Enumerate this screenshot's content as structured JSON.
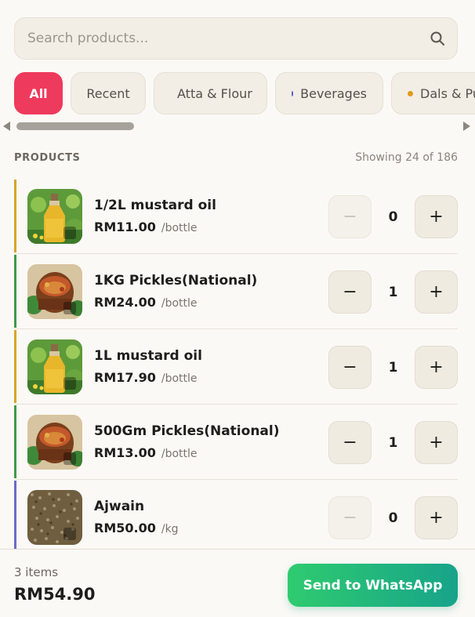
{
  "search": {
    "placeholder": "Search products..."
  },
  "categories": [
    {
      "label": "All",
      "active": true,
      "dot": ""
    },
    {
      "label": "Recent",
      "active": false,
      "dot": ""
    },
    {
      "label": "Atta & Flour",
      "active": false,
      "dot": "#b6581d"
    },
    {
      "label": "Beverages",
      "active": false,
      "dot": "#5757cc"
    },
    {
      "label": "Dals & Pu",
      "active": false,
      "dot": "#e09a1c"
    }
  ],
  "list": {
    "title": "PRODUCTS",
    "count": "Showing 24 of 186"
  },
  "products": [
    {
      "name": "1/2L mustard oil",
      "price": "RM11.00",
      "unit": "/bottle",
      "qty": "0",
      "accent": "#d9a42a",
      "image": "oil-bottle"
    },
    {
      "name": "1KG Pickles(National)",
      "price": "RM24.00",
      "unit": "/bottle",
      "qty": "1",
      "accent": "#3f9a4a",
      "image": "pickle-jar"
    },
    {
      "name": "1L mustard oil",
      "price": "RM17.90",
      "unit": "/bottle",
      "qty": "1",
      "accent": "#d9a42a",
      "image": "oil-bottle"
    },
    {
      "name": "500Gm Pickles(National)",
      "price": "RM13.00",
      "unit": "/bottle",
      "qty": "1",
      "accent": "#3f9a4a",
      "image": "pickle-jar"
    },
    {
      "name": "Ajwain",
      "price": "RM50.00",
      "unit": "/kg",
      "qty": "0",
      "accent": "#6b6bc8",
      "image": "ajwain-seeds"
    }
  ],
  "footer": {
    "items": "3 items",
    "total": "RM54.90",
    "button": "Send to WhatsApp"
  },
  "icons": {
    "search": "search-icon",
    "minus": "−",
    "plus": "+"
  },
  "colors": {
    "accent_all": "#ee3a5c",
    "whatsapp_start": "#2fcb6f",
    "whatsapp_end": "#17a38a"
  }
}
